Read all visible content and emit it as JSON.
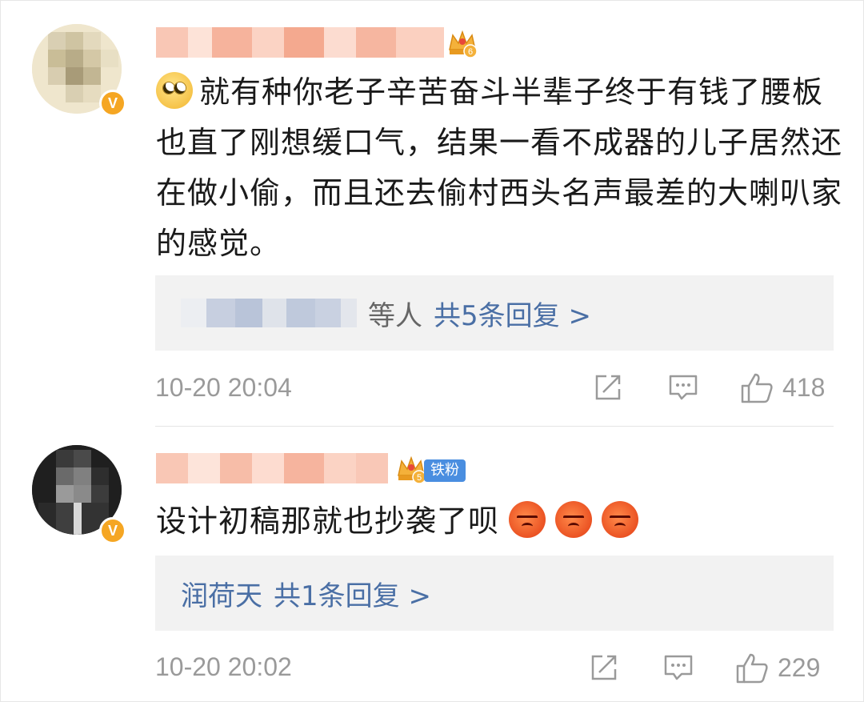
{
  "comments": [
    {
      "verified_badge": "V",
      "level_badge": "6",
      "text": "就有种你老子辛苦奋斗半辈子终于有钱了腰板也直了刚想缓口气，结果一看不成器的儿子居然还在做小偷，而且还去偷村西头名声最差的大喇叭家的感觉。",
      "emoji": "eye-roll-emoji",
      "replies": {
        "others": "等人",
        "count_label": "共5条回复 >"
      },
      "time": "10-20 20:04",
      "likes": "418"
    },
    {
      "verified_badge": "V",
      "level_badge": "5",
      "fan_badge": "铁粉",
      "text": "设计初稿那就也抄袭了呗",
      "emoji": "angry-emoji",
      "replies": {
        "user": "润荷天",
        "count_label": "共1条回复 >"
      },
      "time": "10-20 20:02",
      "likes": "229"
    }
  ],
  "colors": {
    "link": "#4a6fa5",
    "meta": "#9a9a9a",
    "reply_bg": "#f2f2f2",
    "verified": "#f5a623",
    "fan_badge": "#4a8ee0",
    "name_blur": "#f7b8a2"
  }
}
